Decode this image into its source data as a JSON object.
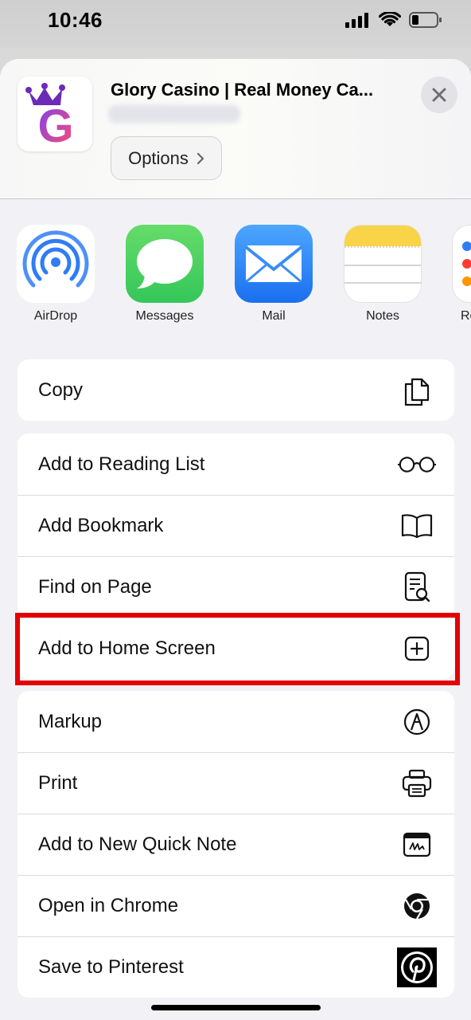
{
  "status_bar": {
    "time": "10:46"
  },
  "header": {
    "title": "Glory Casino | Real Money Ca...",
    "options_label": "Options",
    "app_icon_letter": "G"
  },
  "share_apps": [
    {
      "label": "AirDrop"
    },
    {
      "label": "Messages"
    },
    {
      "label": "Mail"
    },
    {
      "label": "Notes"
    },
    {
      "label": "Re"
    }
  ],
  "actions": {
    "copy": "Copy",
    "reading_list": "Add to Reading List",
    "bookmark": "Add Bookmark",
    "find": "Find on Page",
    "home_screen": "Add to Home Screen",
    "markup": "Markup",
    "print": "Print",
    "quick_note": "Add to New Quick Note",
    "chrome": "Open in Chrome",
    "pinterest": "Save to Pinterest"
  },
  "colors": {
    "highlight": "#e60000",
    "airdrop_blue": "#2f7cf6",
    "messages_green": "#34c759",
    "mail_blue": "#2a8cf5",
    "notes_yellow": "#f9d348"
  }
}
